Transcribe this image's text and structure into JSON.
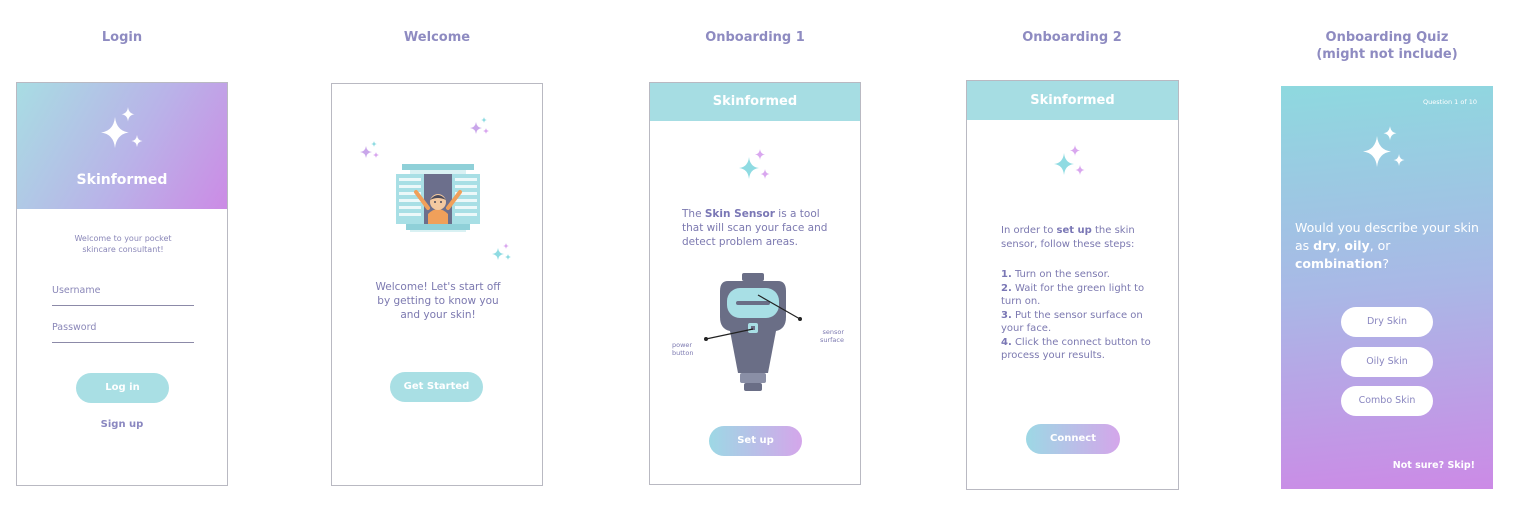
{
  "screens": {
    "login": {
      "title": "Login",
      "brand": "Skinformed",
      "welcome": "Welcome to your pocket skincare consultant!",
      "username_placeholder": "Username",
      "password_placeholder": "Password",
      "login_label": "Log in",
      "signup_label": "Sign up"
    },
    "welcome": {
      "title": "Welcome",
      "message": "Welcome! Let's start off by getting to know you and your skin!",
      "cta_label": "Get Started"
    },
    "onboarding1": {
      "title": "Onboarding 1",
      "header": "Skinformed",
      "intro_pre": "The ",
      "intro_em": "Skin Sensor",
      "intro_post": " is a tool that will scan your face and detect problem areas.",
      "label_power": "power button",
      "label_sensor": "sensor surface",
      "cta_label": "Set up"
    },
    "onboarding2": {
      "title": "Onboarding 2",
      "header": "Skinformed",
      "intro_pre": "In order to ",
      "intro_em": "set up",
      "intro_post": " the skin sensor, follow these steps:",
      "steps": [
        {
          "num": "1.",
          "text": " Turn on the sensor."
        },
        {
          "num": "2.",
          "text": " Wait for the green light to turn on."
        },
        {
          "num": "3.",
          "text": " Put the sensor surface on your face."
        },
        {
          "num": "4.",
          "text": " Click the connect button to process your results."
        }
      ],
      "cta_label": "Connect"
    },
    "quiz": {
      "title_line1": "Onboarding Quiz",
      "title_line2": "(might not include)",
      "counter": "Question 1 of 10",
      "q_pre": "Would you describe your skin as ",
      "q_dry": "dry",
      "q_sep1": ", ",
      "q_oily": "oily",
      "q_sep2": ", or ",
      "q_combo": "combination",
      "q_end": "?",
      "options": [
        "Dry Skin",
        "Oily Skin",
        "Combo Skin"
      ],
      "skip_label": "Not sure? Skip!"
    }
  },
  "colors": {
    "teal": "#a6dde3",
    "lavender": "#c98ce6",
    "title_text": "#8e8bc1",
    "sparkle_teal": "#8fdbe2",
    "sparkle_pink": "#d9a7ef"
  },
  "icons": [
    "sparkle-icon",
    "window-illustration",
    "skin-sensor-illustration"
  ]
}
